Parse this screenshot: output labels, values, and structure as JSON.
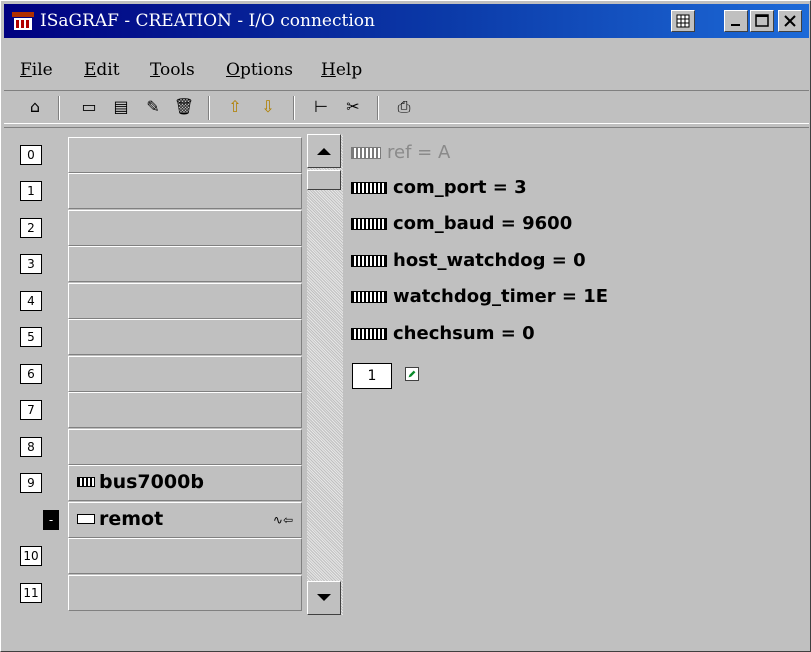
{
  "window": {
    "title": "ISaGRAF - CREATION - I/O connection"
  },
  "menu": [
    {
      "label": "File",
      "hot": "F",
      "rest": "ile"
    },
    {
      "label": "Edit",
      "hot": "E",
      "rest": "dit"
    },
    {
      "label": "Tools",
      "hot": "T",
      "rest": "ools"
    },
    {
      "label": "Options",
      "hot": "O",
      "rest": "ptions"
    },
    {
      "label": "Help",
      "hot": "H",
      "rest": "elp"
    }
  ],
  "toolbar": {
    "icons": [
      "open-icon",
      "board-icon",
      "save-icon",
      "wizard-icon",
      "delete-icon",
      "up-arrow-icon",
      "down-arrow-icon",
      "connect-icon",
      "cut-icon",
      "print-icon"
    ],
    "glyphs": [
      "⌂",
      "▭",
      "▤",
      "✎",
      "🗑",
      "⇧",
      "⇩",
      "⊢",
      "✂",
      "⎙"
    ]
  },
  "slots": [
    {
      "number": "0",
      "label": ""
    },
    {
      "number": "1",
      "label": ""
    },
    {
      "number": "2",
      "label": ""
    },
    {
      "number": "3",
      "label": ""
    },
    {
      "number": "4",
      "label": ""
    },
    {
      "number": "5",
      "label": ""
    },
    {
      "number": "6",
      "label": ""
    },
    {
      "number": "7",
      "label": ""
    },
    {
      "number": "8",
      "label": ""
    },
    {
      "number": "9",
      "label": "bus7000b"
    },
    {
      "number": "-",
      "label": "remot",
      "extra": "∿⇦"
    },
    {
      "number": "10",
      "label": ""
    },
    {
      "number": "11",
      "label": ""
    }
  ],
  "params": [
    "ref = A",
    "com_port = 3",
    "com_baud = 9600",
    "host_watchdog = 0",
    "watchdog_timer = 1E",
    "chechsum = 0"
  ],
  "channel": {
    "number": "1"
  },
  "colors": {
    "titlebar": "#000080",
    "face": "#c0c0c0"
  }
}
